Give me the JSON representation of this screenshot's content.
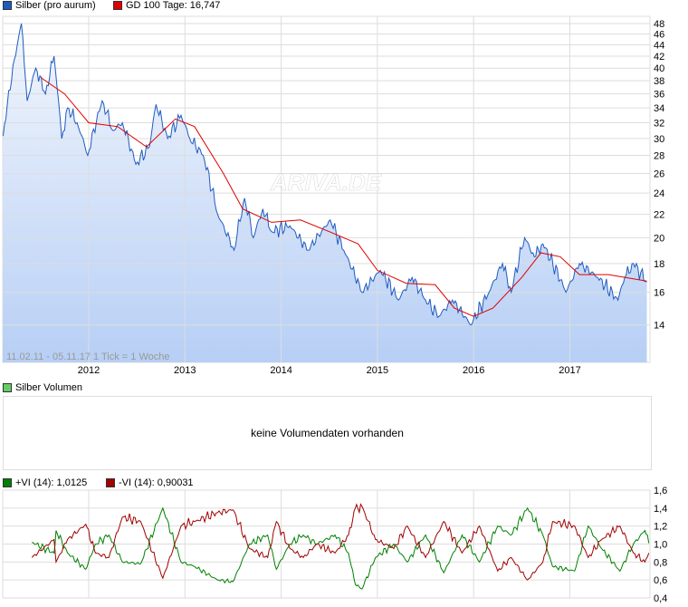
{
  "legend": {
    "price": "Silber (pro aurum)",
    "sma": "GD 100 Tage: 16,747",
    "volume": "Silber Volumen",
    "vi_plus": "+VI (14): 1,0125",
    "vi_minus": "-VI (14): 0,90031"
  },
  "colors": {
    "price": "#1f5bbf",
    "sma": "#e00000",
    "vol": "#66cc66",
    "vi_plus": "#008000",
    "vi_minus": "#a00000"
  },
  "watermark": "ARIVA.DE",
  "range_note": "11.02.11 - 05.11.17   1 Tick = 1 Woche",
  "volume_message": "keine Volumendaten vorhanden",
  "chart_data": [
    {
      "type": "area",
      "title": "Silber (pro aurum)",
      "scale": "log",
      "ylim": [
        12.5,
        50
      ],
      "yticks": [
        14,
        16,
        18,
        20,
        22,
        24,
        26,
        28,
        30,
        32,
        34,
        36,
        38,
        40,
        42,
        44,
        46,
        48
      ],
      "xticks": [
        2012,
        2013,
        2014,
        2015,
        2016,
        2017
      ],
      "series": [
        {
          "name": "Silber (pro aurum)",
          "points": [
            [
              2011.11,
              30.3
            ],
            [
              2011.3,
              48
            ],
            [
              2011.36,
              35
            ],
            [
              2011.45,
              40
            ],
            [
              2011.55,
              36
            ],
            [
              2011.64,
              42
            ],
            [
              2011.72,
              30
            ],
            [
              2011.78,
              34
            ],
            [
              2011.88,
              32
            ],
            [
              2011.99,
              28
            ],
            [
              2012.14,
              35
            ],
            [
              2012.25,
              31
            ],
            [
              2012.35,
              32
            ],
            [
              2012.49,
              27
            ],
            [
              2012.63,
              29
            ],
            [
              2012.7,
              34.5
            ],
            [
              2012.82,
              30
            ],
            [
              2012.96,
              33
            ],
            [
              2013.05,
              30
            ],
            [
              2013.19,
              28
            ],
            [
              2013.34,
              22
            ],
            [
              2013.51,
              19
            ],
            [
              2013.62,
              23.5
            ],
            [
              2013.71,
              20
            ],
            [
              2013.81,
              22.5
            ],
            [
              2013.9,
              20.5
            ],
            [
              2014.09,
              21
            ],
            [
              2014.28,
              19
            ],
            [
              2014.51,
              21.5
            ],
            [
              2014.65,
              19
            ],
            [
              2014.84,
              16
            ],
            [
              2015.03,
              17.5
            ],
            [
              2015.22,
              15.5
            ],
            [
              2015.36,
              17
            ],
            [
              2015.5,
              15.5
            ],
            [
              2015.64,
              14.5
            ],
            [
              2015.78,
              15.5
            ],
            [
              2015.97,
              14
            ],
            [
              2016.16,
              16
            ],
            [
              2016.3,
              18
            ],
            [
              2016.39,
              16
            ],
            [
              2016.53,
              20
            ],
            [
              2016.63,
              18.5
            ],
            [
              2016.72,
              19.5
            ],
            [
              2016.96,
              16
            ],
            [
              2017.1,
              18
            ],
            [
              2017.29,
              17
            ],
            [
              2017.5,
              15.5
            ],
            [
              2017.57,
              17
            ],
            [
              2017.66,
              18
            ],
            [
              2017.8,
              16.7
            ]
          ]
        },
        {
          "name": "GD 100 Tage",
          "points": [
            [
              2011.5,
              38.5
            ],
            [
              2011.75,
              36
            ],
            [
              2012.0,
              32
            ],
            [
              2012.3,
              31.5
            ],
            [
              2012.6,
              29
            ],
            [
              2012.9,
              32.5
            ],
            [
              2013.1,
              31.5
            ],
            [
              2013.4,
              26
            ],
            [
              2013.6,
              22.5
            ],
            [
              2013.9,
              21.3
            ],
            [
              2014.2,
              21.5
            ],
            [
              2014.5,
              20.5
            ],
            [
              2014.8,
              19.5
            ],
            [
              2015.0,
              17.5
            ],
            [
              2015.3,
              16.6
            ],
            [
              2015.6,
              16.5
            ],
            [
              2015.8,
              15
            ],
            [
              2016.0,
              14.5
            ],
            [
              2016.2,
              15
            ],
            [
              2016.5,
              17
            ],
            [
              2016.7,
              18.8
            ],
            [
              2016.9,
              18.5
            ],
            [
              2017.1,
              17.2
            ],
            [
              2017.4,
              17.2
            ],
            [
              2017.8,
              16.75
            ]
          ]
        }
      ]
    },
    {
      "type": "line",
      "title": "Vortex Indicator (14)",
      "ylim": [
        0.4,
        1.6
      ],
      "yticks": [
        "0,4",
        "0,6",
        "0,8",
        "1,0",
        "1,2",
        "1,4",
        "1,6"
      ],
      "x": [
        2011.41,
        2011.64,
        2011.66,
        2011.78,
        2011.97,
        2012.07,
        2012.21,
        2012.35,
        2012.54,
        2012.77,
        2012.96,
        2013.1,
        2013.34,
        2013.5,
        2013.67,
        2013.86,
        2013.95,
        2014.09,
        2014.23,
        2014.37,
        2014.56,
        2014.7,
        2014.77,
        2014.84,
        2014.98,
        2015.17,
        2015.31,
        2015.5,
        2015.69,
        2015.88,
        2016.06,
        2016.25,
        2016.39,
        2016.56,
        2016.72,
        2016.82,
        2017.05,
        2017.19,
        2017.33,
        2017.52,
        2017.66,
        2017.78,
        2017.82
      ],
      "series": [
        {
          "name": "+VI (14)",
          "values": [
            1.02,
            0.9,
            1.15,
            0.9,
            0.72,
            1.0,
            1.1,
            0.8,
            0.78,
            1.4,
            0.8,
            0.75,
            0.6,
            0.58,
            1.0,
            1.1,
            0.72,
            1.0,
            1.1,
            1.0,
            1.1,
            0.9,
            0.55,
            0.5,
            0.85,
            1.0,
            0.8,
            1.1,
            0.68,
            1.1,
            0.8,
            1.2,
            1.1,
            1.4,
            1.1,
            0.75,
            0.7,
            1.2,
            0.95,
            0.7,
            1.0,
            1.15,
            1.01
          ]
        },
        {
          "name": "-VI (14)",
          "values": [
            0.85,
            1.05,
            0.8,
            1.05,
            1.22,
            0.9,
            0.85,
            1.3,
            1.25,
            0.62,
            1.2,
            1.25,
            1.35,
            1.38,
            0.95,
            0.85,
            1.25,
            0.95,
            0.85,
            1.0,
            0.9,
            1.1,
            1.4,
            1.42,
            1.05,
            0.95,
            1.2,
            0.85,
            1.25,
            0.9,
            1.2,
            0.7,
            0.85,
            0.6,
            0.8,
            1.25,
            1.2,
            0.85,
            1.05,
            1.2,
            0.9,
            0.8,
            0.9
          ]
        }
      ]
    }
  ]
}
